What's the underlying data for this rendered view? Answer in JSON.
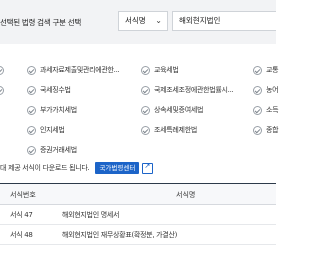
{
  "search": {
    "label": "선택된 법령 검색 구분 선택",
    "select_value": "서식명",
    "input_value": "해외현지법인"
  },
  "checkboxes": [
    {
      "label": "과세자료제출및관리에관한..."
    },
    {
      "label": "교육세법"
    },
    {
      "label": "교통"
    },
    {
      "label": "국세징수법"
    },
    {
      "label": "국제조세조정에관한법률시..."
    },
    {
      "label": "농어"
    },
    {
      "label": "부가가치세법"
    },
    {
      "label": "상속세및증여세법"
    },
    {
      "label": "소득"
    },
    {
      "label": "인지세법"
    },
    {
      "label": "조세특례제한법"
    },
    {
      "label": "종합"
    },
    {
      "label": "증권거래세법"
    }
  ],
  "notice": {
    "text": "대 제공 서식이 다운로드 됩니다.",
    "button_label": "국가법령센터"
  },
  "table": {
    "headers": {
      "number": "서식번호",
      "name": "서식명"
    },
    "rows": [
      {
        "number": "서식 47",
        "name": "해외현지법인 명세서"
      },
      {
        "number": "서식 48",
        "name": "해외현지법인 재무상황표(확정분, 가결산)"
      }
    ]
  }
}
